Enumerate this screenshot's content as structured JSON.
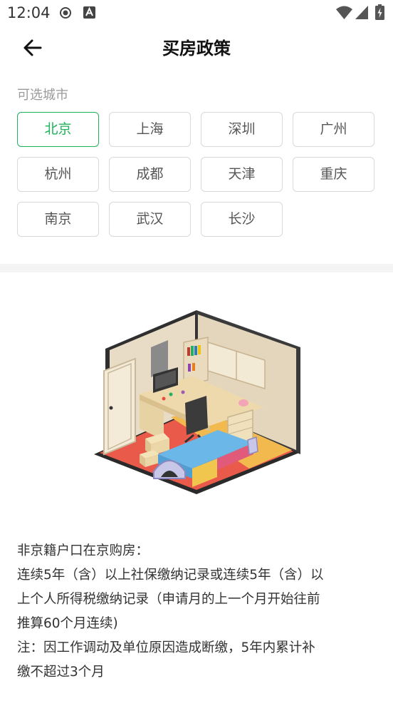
{
  "status_bar": {
    "time": "12:04"
  },
  "header": {
    "title": "买房政策"
  },
  "cities": {
    "label": "可选城市",
    "selected": "北京",
    "items": [
      "北京",
      "上海",
      "深圳",
      "广州",
      "杭州",
      "成都",
      "天津",
      "重庆",
      "南京",
      "武汉",
      "长沙"
    ]
  },
  "policy": {
    "lines": [
      "非京籍户口在京购房：",
      "连续5年（含）以上社保缴纳记录或连续5年（含）以",
      "上个人所得税缴纳记录（申请月的上一个月开始往前",
      "推算60个月连续)",
      "注：因工作调动及单位原因造成断缴，5年内累计补",
      "缴不超过3个月"
    ]
  },
  "colors": {
    "accent": "#1fb35a",
    "border": "#d9d9d9"
  },
  "icons": [
    "record-icon",
    "a-icon",
    "wifi-icon",
    "signal-icon",
    "battery-icon",
    "back-arrow-icon"
  ]
}
